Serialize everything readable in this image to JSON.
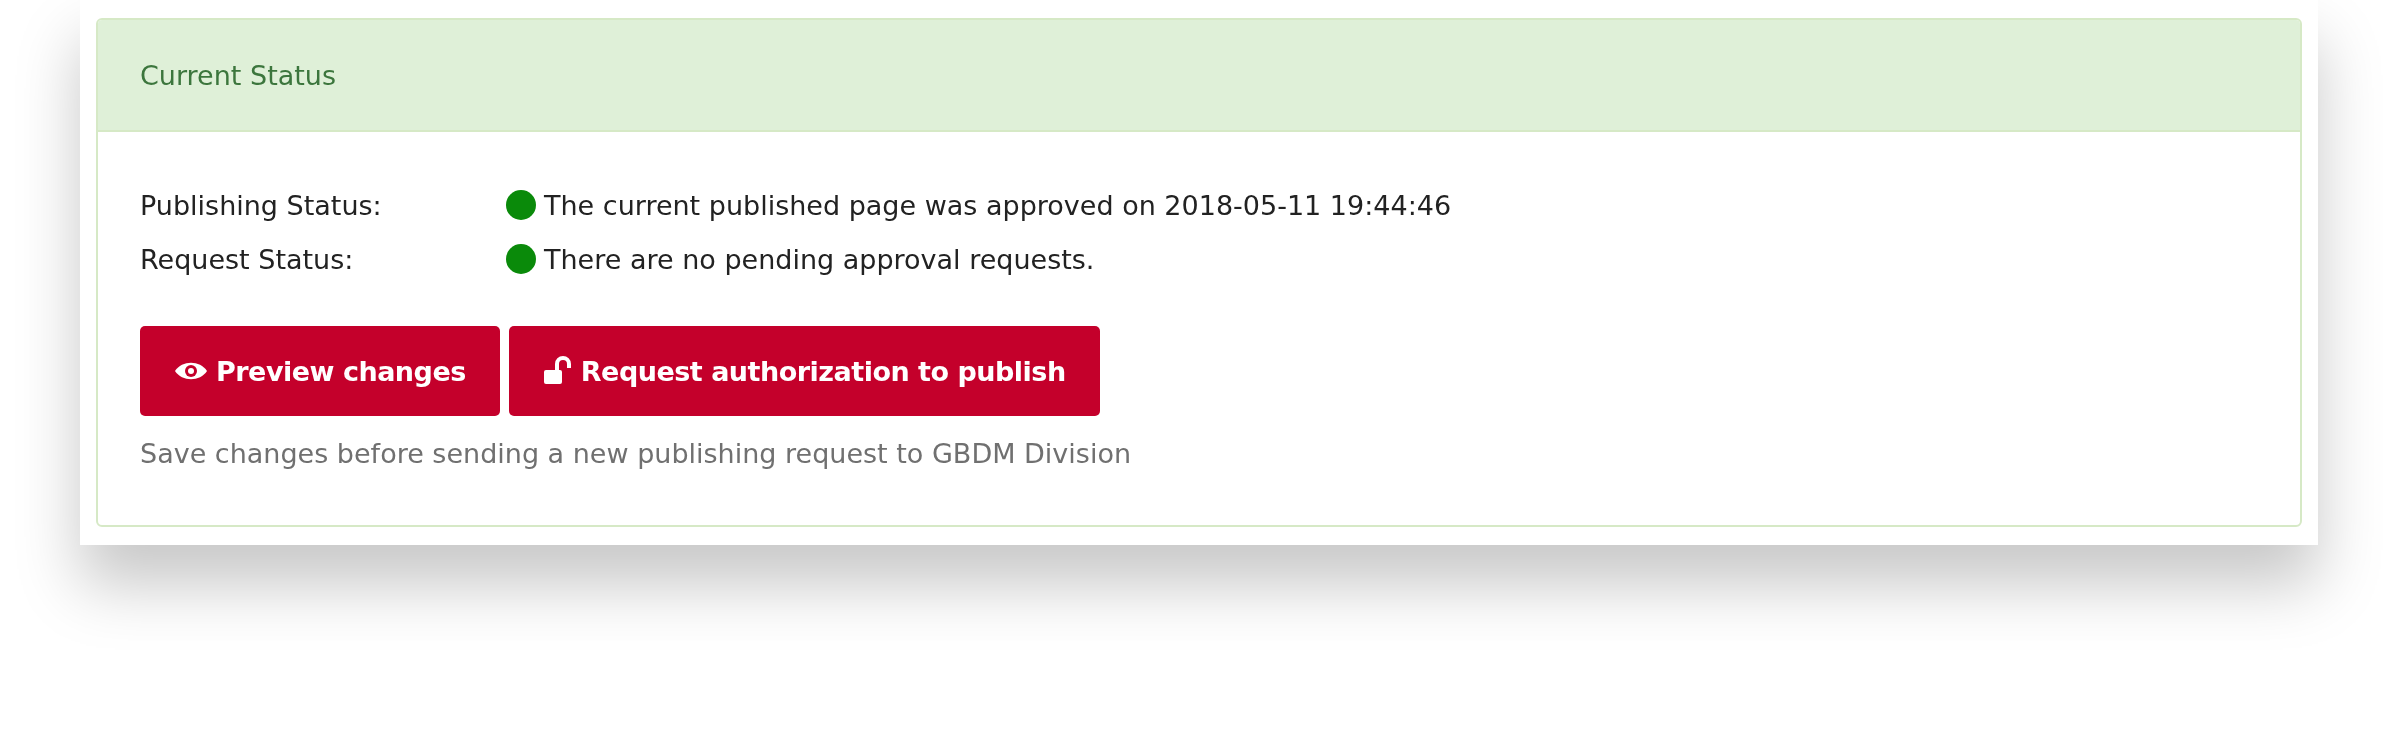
{
  "panel": {
    "title": "Current Status",
    "statuses": [
      {
        "label": "Publishing Status:",
        "color": "#0a8a0a",
        "text": "The current published page was approved on 2018-05-11 19:44:46"
      },
      {
        "label": "Request Status:",
        "color": "#0a8a0a",
        "text": "There are no pending approval requests."
      }
    ],
    "buttons": [
      {
        "kind": "preview",
        "label": "Preview changes"
      },
      {
        "kind": "unlock",
        "label": "Request authorization to publish"
      }
    ],
    "hint": "Save changes before sending a new publishing request to GBDM Division"
  }
}
